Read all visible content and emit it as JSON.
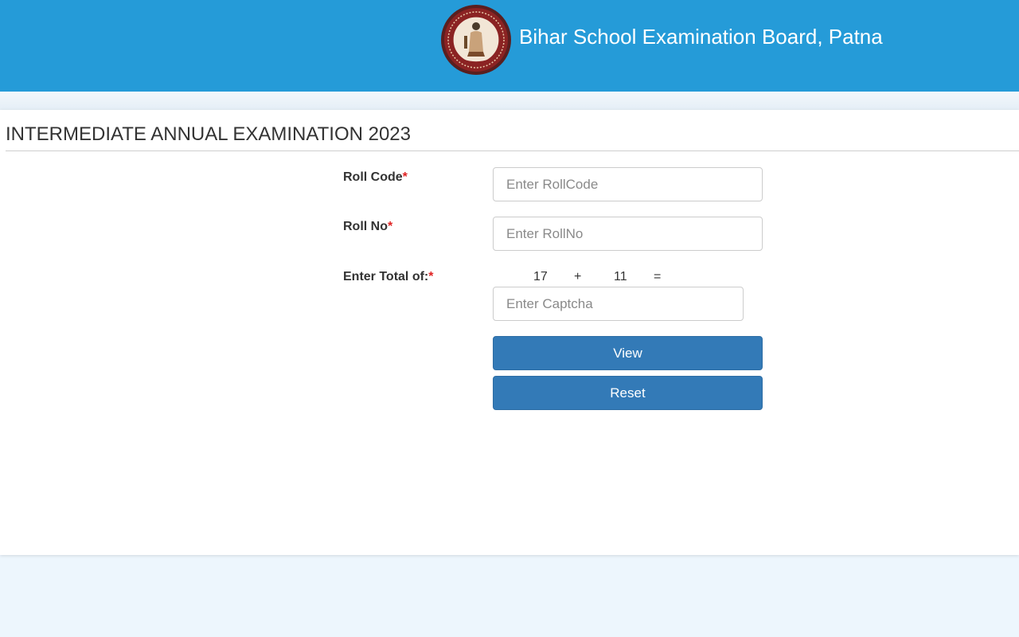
{
  "header": {
    "board_name": "Bihar School Examination Board, Patna",
    "logo_icon": "bseb-emblem-icon"
  },
  "page": {
    "exam_title": "INTERMEDIATE ANNUAL EXAMINATION 2023"
  },
  "form": {
    "roll_code": {
      "label": "Roll Code",
      "required_mark": "*",
      "value": "",
      "placeholder": "Enter RollCode"
    },
    "roll_no": {
      "label": "Roll No",
      "required_mark": "*",
      "value": "",
      "placeholder": "Enter RollNo"
    },
    "captcha": {
      "label": "Enter Total of:",
      "required_mark": "*",
      "operand_a": "17",
      "operator": "+",
      "operand_b": "11",
      "equals": "=",
      "value": "",
      "placeholder": "Enter Captcha"
    },
    "view_label": "View",
    "reset_label": "Reset"
  },
  "colors": {
    "header_bg": "#259bd8",
    "button_bg": "#337ab7",
    "required": "#e02222",
    "page_bg": "#edf6fd"
  }
}
